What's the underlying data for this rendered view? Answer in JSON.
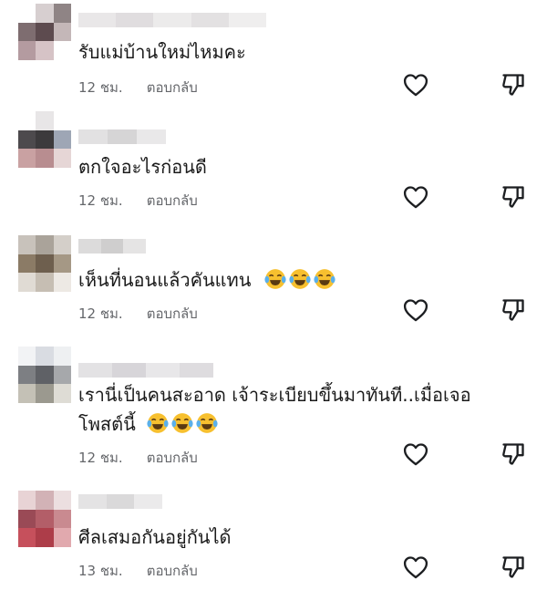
{
  "comments": [
    {
      "text": "รับแม่บ้านใหม่ไหมคะ",
      "time": "12 ชม.",
      "reply": "ตอบกลับ",
      "emoji_count": 0,
      "text2": ""
    },
    {
      "text": "ตกใจอะไรก่อนดี",
      "time": "12 ชม.",
      "reply": "ตอบกลับ",
      "emoji_count": 0,
      "text2": ""
    },
    {
      "text": "เห็นที่นอนแล้วคันแทน",
      "time": "12 ชม.",
      "reply": "ตอบกลับ",
      "emoji_count": 3,
      "text2": ""
    },
    {
      "text": "เรานี่เป็นคนสะอาด เจ้าระเบียบขึ้นมาทันที..เมื่อเจอ",
      "text2": "โพสต์นี้",
      "time": "12 ชม.",
      "reply": "ตอบกลับ",
      "emoji_count": 3
    },
    {
      "text": "ศีลเสมอกันอยู่กันได้",
      "time": "13 ชม.",
      "reply": "ตอบกลับ",
      "emoji_count": 0,
      "text2": ""
    }
  ],
  "icons": {
    "like": "heart-icon",
    "dislike": "thumbs-down-icon",
    "emoji": "face-with-tears-of-joy-emoji"
  },
  "colors": {
    "meta_text": "#65676b",
    "icon_stroke": "#1c1e21",
    "emoji_yellow": "#f7c02f"
  }
}
